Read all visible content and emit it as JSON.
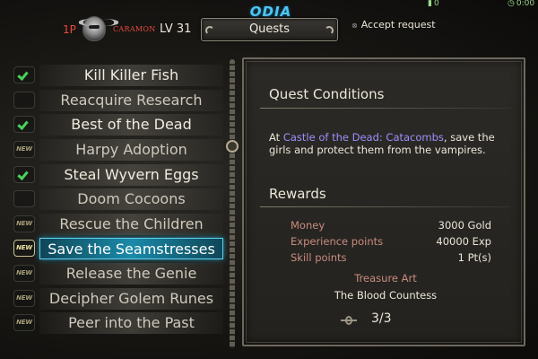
{
  "system": {
    "battery_text": "0",
    "clock_text": "0:00"
  },
  "watermark": "ODIA",
  "header": {
    "player": "1P",
    "character_name": "CARAMON",
    "level": "LV 31",
    "active_tab": "Quests",
    "accept_hint": "Accept request"
  },
  "quests": [
    {
      "title": "Kill Killer Fish",
      "status": "done",
      "badge": ""
    },
    {
      "title": "Reacquire Research",
      "status": "open",
      "badge": ""
    },
    {
      "title": "Best of the Dead",
      "status": "done",
      "badge": ""
    },
    {
      "title": "Harpy Adoption",
      "status": "new",
      "badge": "NEW"
    },
    {
      "title": "Steal Wyvern Eggs",
      "status": "done",
      "badge": ""
    },
    {
      "title": "Doom Cocoons",
      "status": "open",
      "badge": ""
    },
    {
      "title": "Rescue the Children",
      "status": "new",
      "badge": "NEW"
    },
    {
      "title": "Save the Seamstresses",
      "status": "new",
      "badge": "NEW",
      "selected": true
    },
    {
      "title": "Release the Genie",
      "status": "new",
      "badge": "NEW"
    },
    {
      "title": "Decipher Golem Runes",
      "status": "new",
      "badge": "NEW"
    },
    {
      "title": "Peer into the Past",
      "status": "new",
      "badge": "NEW"
    }
  ],
  "details": {
    "conditions_title": "Quest Conditions",
    "conditions": {
      "prefix": "At ",
      "location": "Castle of the Dead: Catacombs",
      "suffix": ", save the girls and protect them from the vampires."
    },
    "rewards_title": "Rewards",
    "rewards": [
      {
        "label": "Money",
        "value": "3000 Gold"
      },
      {
        "label": "Experience points",
        "value": "40000 Exp"
      },
      {
        "label": "Skill points",
        "value": "1 Pt(s)"
      }
    ],
    "treasure_art_label": "Treasure Art",
    "treasure_art_value": "The Blood Countess",
    "progress": "3/3"
  },
  "colors": {
    "accent_selected": "#1a8aa9",
    "check_green": "#4bd15a",
    "location_purple": "#9d90ff",
    "reward_label": "#c88b80",
    "player_red": "#e84a3e"
  },
  "icons": {
    "status_done": "checkmark-icon",
    "accept_button": "x-button-icon",
    "progress": "scroll-icon"
  }
}
